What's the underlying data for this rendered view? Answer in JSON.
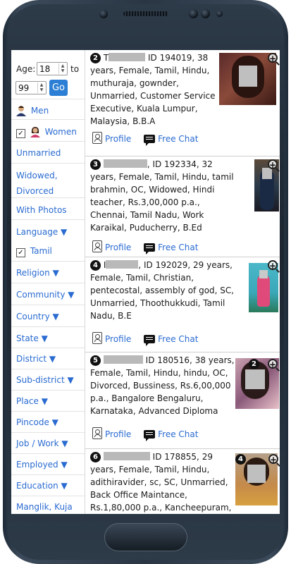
{
  "filters": {
    "age_label": "Age:",
    "age_min": "18",
    "to_label": "to",
    "age_max": "99",
    "go_label": "Go",
    "men_label": "Men",
    "women_label": "Women",
    "women_checked": "✓",
    "unmarried_label": "Unmarried",
    "widowed_label": "Widowed, Divorced",
    "with_photos_label": "With Photos",
    "language_label": "Language ▼",
    "tamil_label": "Tamil",
    "tamil_checked": "✓",
    "religion_label": "Religion ▼",
    "community_label": "Community ▼",
    "country_label": "Country ▼",
    "state_label": "State ▼",
    "district_label": "District ▼",
    "subdistrict_label": "Sub-district ▼",
    "place_label": "Place ▼",
    "pincode_label": "Pincode ▼",
    "job_label": "Job / Work ▼",
    "employed_label": "Employed ▼",
    "education_label": "Education ▼",
    "manglik_label": "Manglik, Kuja"
  },
  "actions": {
    "profile_label": "Profile",
    "chat_label": "Free Chat"
  },
  "results": [
    {
      "number": "2",
      "name_visible": "T",
      "details": "ID 194019, 38 years, Female, Tamil, Hindu, muthuraja, gownder, Unmarried, Customer Service Executive, Kuala Lumpur, Malaysia, B.B.A",
      "photo_count": ""
    },
    {
      "number": "3",
      "name_visible": "",
      "details": ", ID 192334, 32 years, Female, Tamil, Hindu, tamil brahmin, OC, Widowed, Hindi teacher, Rs.3,00,000 p.a., Chennai, Tamil Nadu, Work Karaikal, Puducherry, B.Ed",
      "photo_count": ""
    },
    {
      "number": "4",
      "name_visible": "I",
      "details": ", ID 192029, 29 years, Female, Tamil, Christian, pentecostal, assembly of god, SC, Unmarried, Thoothukkudi, Tamil Nadu, B.E",
      "photo_count": ""
    },
    {
      "number": "5",
      "name_visible": "",
      "details": "ID 180516, 38 years, Female, Tamil, Hindu, hindu, OC, Divorced, Bussiness, Rs.6,00,000 p.a., Bangalore Bengaluru, Karnataka, Advanced Diploma",
      "photo_count": "2"
    },
    {
      "number": "6",
      "name_visible": "",
      "details": "ID 178855, 29 years, Female, Tamil, Hindu, adithiravider, sc, SC, Unmarried, Back Office Maintance, Rs.1,80,000 p.a., Kancheepuram,",
      "photo_count": "4"
    }
  ],
  "icons": {
    "zoom": "zoom-in-icon",
    "profile": "profile-card-icon",
    "chat": "chat-bubble-icon",
    "men": "man-avatar-icon",
    "women": "woman-avatar-icon"
  }
}
